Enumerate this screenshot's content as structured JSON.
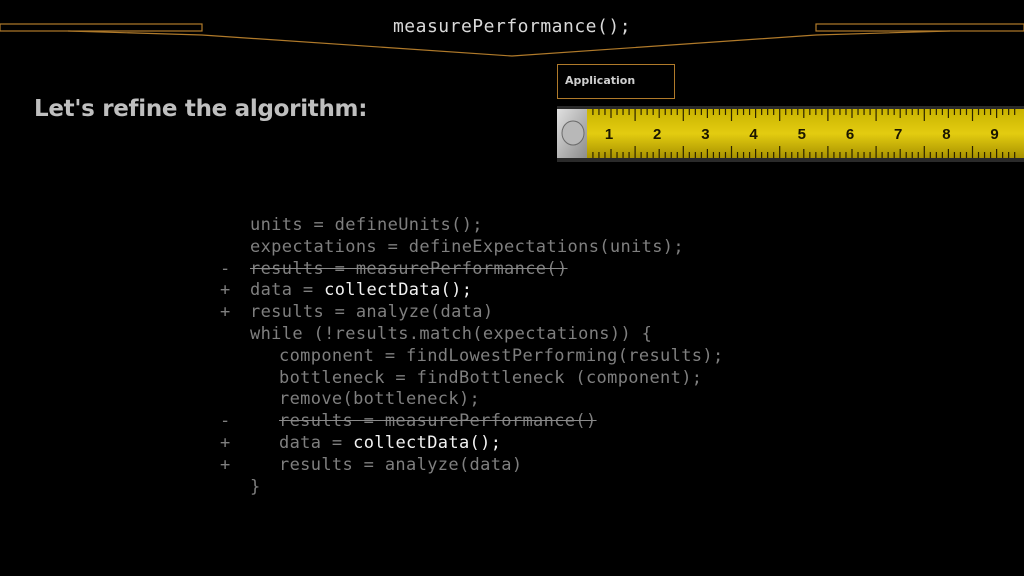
{
  "header": {
    "title": "measurePerformance();"
  },
  "heading": "Let's refine the algorithm:",
  "app_box": {
    "label": "Application"
  },
  "tape_numbers": [
    "1",
    "2",
    "3",
    "4",
    "5",
    "6",
    "7",
    "8",
    "9"
  ],
  "accent_color": "#b07a2a",
  "code_lines": [
    {
      "marker": "",
      "indent": 0,
      "pre": "units = defineUnits();",
      "hl": "",
      "post": "",
      "removed": false
    },
    {
      "marker": "",
      "indent": 0,
      "pre": "expectations = defineExpectations(units);",
      "hl": "",
      "post": "",
      "removed": false
    },
    {
      "marker": "-",
      "indent": 0,
      "pre": "results = measurePerformance()",
      "hl": "",
      "post": "",
      "removed": true
    },
    {
      "marker": "+",
      "indent": 0,
      "pre": "data = ",
      "hl": "collectData();",
      "post": "",
      "removed": false
    },
    {
      "marker": "+",
      "indent": 0,
      "pre": "results = analyze(data)",
      "hl": "",
      "post": "",
      "removed": false
    },
    {
      "marker": "",
      "indent": 0,
      "pre": "while (!results.match(expectations)) {",
      "hl": "",
      "post": "",
      "removed": false
    },
    {
      "marker": "",
      "indent": 1,
      "pre": "component = findLowestPerforming(results);",
      "hl": "",
      "post": "",
      "removed": false
    },
    {
      "marker": "",
      "indent": 1,
      "pre": "bottleneck = findBottleneck (component);",
      "hl": "",
      "post": "",
      "removed": false
    },
    {
      "marker": "",
      "indent": 1,
      "pre": "remove(bottleneck);",
      "hl": "",
      "post": "",
      "removed": false
    },
    {
      "marker": "-",
      "indent": 1,
      "pre": "results = measurePerformance()",
      "hl": "",
      "post": "",
      "removed": true
    },
    {
      "marker": "+",
      "indent": 1,
      "pre": "data = ",
      "hl": "collectData();",
      "post": "",
      "removed": false
    },
    {
      "marker": "+",
      "indent": 1,
      "pre": "results = analyze(data)",
      "hl": "",
      "post": "",
      "removed": false
    },
    {
      "marker": "",
      "indent": 0,
      "pre": "}",
      "hl": "",
      "post": "",
      "removed": false
    }
  ]
}
